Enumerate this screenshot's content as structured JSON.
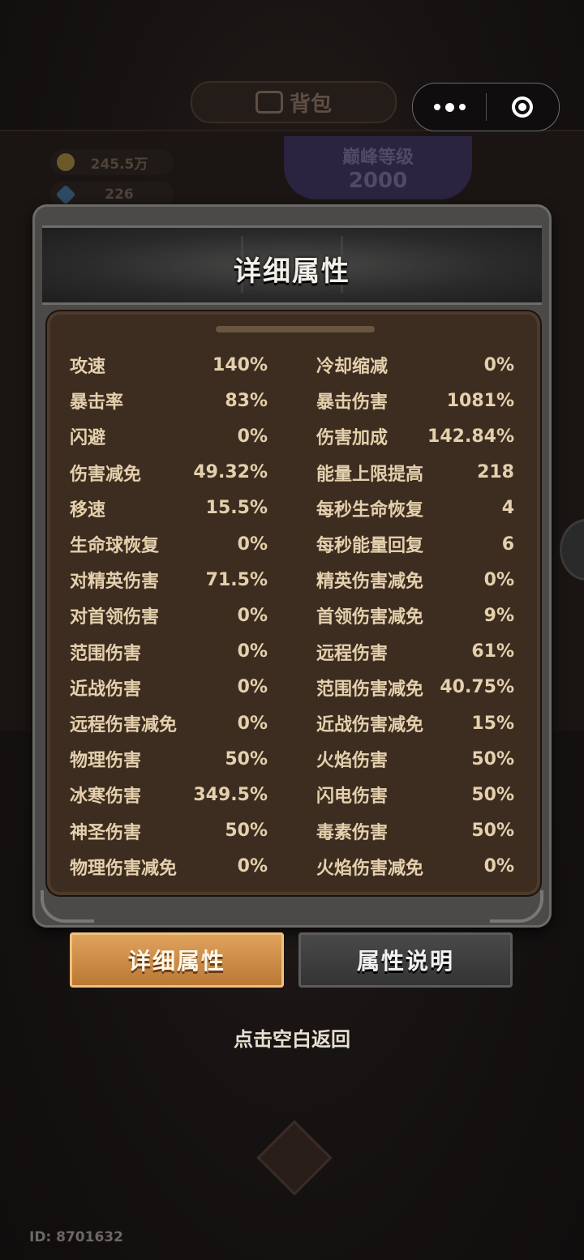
{
  "background": {
    "bag_title": "背包",
    "currencies": [
      {
        "icon": "gold-coin-icon",
        "value": "245.5万"
      },
      {
        "icon": "gem-icon",
        "value": "226"
      }
    ],
    "peak": {
      "label": "巅峰等级",
      "level": "2000"
    }
  },
  "panel": {
    "title": "详细属性",
    "stats_left": [
      {
        "name": "攻速",
        "value": "140%"
      },
      {
        "name": "暴击率",
        "value": "83%"
      },
      {
        "name": "闪避",
        "value": "0%"
      },
      {
        "name": "伤害减免",
        "value": "49.32%"
      },
      {
        "name": "移速",
        "value": "15.5%"
      },
      {
        "name": "生命球恢复",
        "value": "0%"
      },
      {
        "name": "对精英伤害",
        "value": "71.5%"
      },
      {
        "name": "对首领伤害",
        "value": "0%"
      },
      {
        "name": "范围伤害",
        "value": "0%"
      },
      {
        "name": "近战伤害",
        "value": "0%"
      },
      {
        "name": "远程伤害减免",
        "value": "0%"
      },
      {
        "name": "物理伤害",
        "value": "50%"
      },
      {
        "name": "冰寒伤害",
        "value": "349.5%"
      },
      {
        "name": "神圣伤害",
        "value": "50%"
      },
      {
        "name": "物理伤害减免",
        "value": "0%"
      }
    ],
    "stats_right": [
      {
        "name": "冷却缩减",
        "value": "0%"
      },
      {
        "name": "暴击伤害",
        "value": "1081%"
      },
      {
        "name": "伤害加成",
        "value": "142.84%"
      },
      {
        "name": "能量上限提高",
        "value": "218"
      },
      {
        "name": "每秒生命恢复",
        "value": "4"
      },
      {
        "name": "每秒能量回复",
        "value": "6"
      },
      {
        "name": "精英伤害减免",
        "value": "0%"
      },
      {
        "name": "首领伤害减免",
        "value": "9%"
      },
      {
        "name": "远程伤害",
        "value": "61%"
      },
      {
        "name": "范围伤害减免",
        "value": "40.75%"
      },
      {
        "name": "近战伤害减免",
        "value": "15%"
      },
      {
        "name": "火焰伤害",
        "value": "50%"
      },
      {
        "name": "闪电伤害",
        "value": "50%"
      },
      {
        "name": "毒素伤害",
        "value": "50%"
      },
      {
        "name": "火焰伤害减免",
        "value": "0%"
      }
    ]
  },
  "tabs": {
    "detail_label": "详细属性",
    "explain_label": "属性说明"
  },
  "hint": "点击空白返回",
  "user_id": "ID: 8701632",
  "colors": {
    "active_tab": "#c98a45",
    "stat_text": "#e4d0ad",
    "stats_bg": "#3d2d20"
  }
}
